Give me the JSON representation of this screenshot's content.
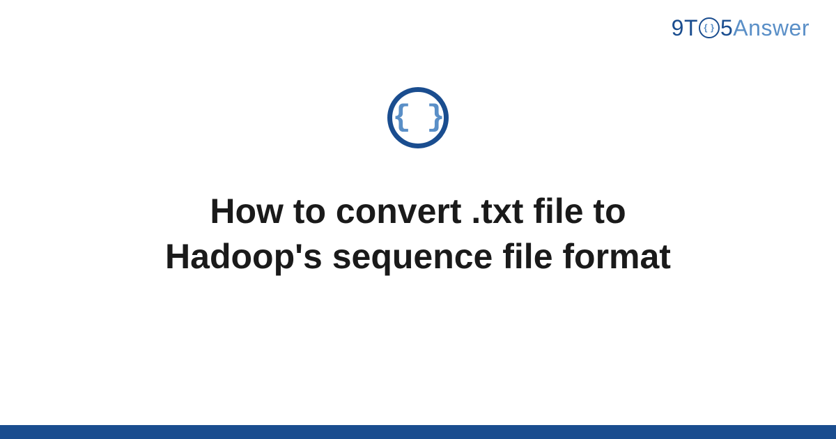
{
  "logo": {
    "part1": "9T",
    "circle_inner": "{ }",
    "part2": "5",
    "part3": "Answer"
  },
  "icon": {
    "braces": "{ }"
  },
  "title": "How to convert .txt file to Hadoop's sequence file format",
  "colors": {
    "primary": "#1a4d8f",
    "secondary": "#5a8fc7"
  }
}
